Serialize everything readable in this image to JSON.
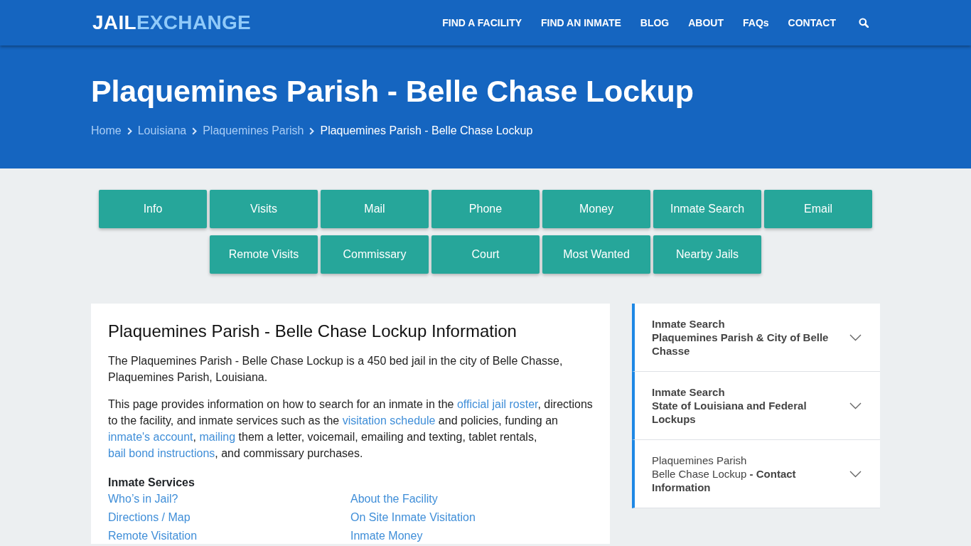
{
  "navbar": {
    "logo": {
      "primary": "JAIL",
      "accent": "EXCHANGE"
    },
    "links": [
      "FIND A FACILITY",
      "FIND AN INMATE",
      "BLOG",
      "ABOUT",
      "FAQs",
      "CONTACT"
    ]
  },
  "hero": {
    "title": "Plaquemines Parish - Belle Chase Lockup",
    "breadcrumb": [
      {
        "label": "Home",
        "current": false
      },
      {
        "label": "Louisiana",
        "current": false
      },
      {
        "label": "Plaquemines Parish",
        "current": false
      },
      {
        "label": "Plaquemines Parish - Belle Chase Lockup",
        "current": true
      }
    ]
  },
  "section_buttons": [
    "Info",
    "Visits",
    "Mail",
    "Phone",
    "Money",
    "Inmate Search",
    "Email",
    "Remote Visits",
    "Commissary",
    "Court",
    "Most Wanted",
    "Nearby Jails"
  ],
  "info_card": {
    "title": "Plaquemines Parish - Belle Chase Lockup Information",
    "paragraphs": [
      [
        {
          "kind": "text",
          "text": "The Plaquemines Parish - Belle Chase Lockup is a 450 bed jail in the city of Belle Chasse, Plaquemines Parish, Louisiana."
        }
      ],
      [
        {
          "kind": "text",
          "text": "This page provides information on how to search for an inmate in the "
        },
        {
          "kind": "link",
          "text": "official jail roster"
        },
        {
          "kind": "text",
          "text": ", directions to the facility, and inmate services such as the "
        },
        {
          "kind": "link",
          "text": "visitation schedule"
        },
        {
          "kind": "text",
          "text": " and policies, funding an "
        },
        {
          "kind": "link",
          "text": "inmate's account"
        },
        {
          "kind": "text",
          "text": ", "
        },
        {
          "kind": "link",
          "text": "mailing"
        },
        {
          "kind": "text",
          "text": " them a letter, voicemail, emailing and texting, tablet rentals, "
        },
        {
          "kind": "link",
          "text": "bail bond instructions"
        },
        {
          "kind": "text",
          "text": ", and commissary purchases."
        }
      ]
    ],
    "services": {
      "heading": "Inmate Services",
      "links": [
        "Who’s in Jail?",
        "About the Facility",
        "Directions / Map",
        "On Site Inmate Visitation",
        "Remote Visitation",
        "Inmate Money"
      ]
    }
  },
  "sidebar": {
    "items": [
      {
        "kind": "search",
        "heading": "Inmate Search",
        "subtitle": "Plaquemines Parish & City of Belle Chasse",
        "expanded": false
      },
      {
        "kind": "search",
        "heading": "Inmate Search",
        "subtitle": "State of Louisiana and Federal Lockups",
        "expanded": false
      },
      {
        "kind": "contact",
        "heading": "Plaquemines Parish",
        "subtitle": "Belle Chase Lockup **- Contact Information**",
        "expanded": false
      }
    ]
  }
}
